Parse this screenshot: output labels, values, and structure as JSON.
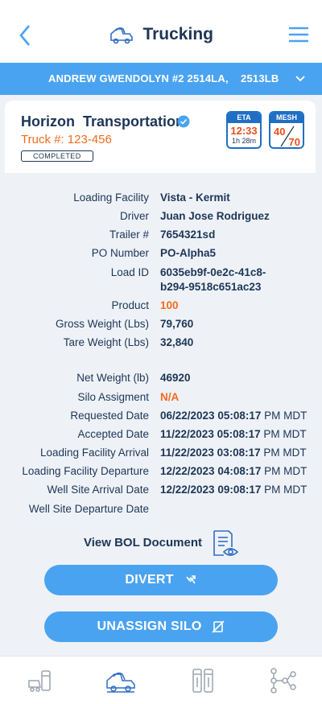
{
  "header": {
    "title": "Trucking",
    "back_icon": "back-icon",
    "truck_icon": "truck-icon",
    "menu_icon": "menu-icon"
  },
  "selector": {
    "label": "ANDREW GWENDOLYN #2 2514LA,    2513LB",
    "chevron_icon": "chevron-down-icon"
  },
  "card": {
    "company": "Horizon  Transportation",
    "truck_number": "Truck #: 123-456",
    "status": "COMPLETED",
    "eta": {
      "header": "ETA",
      "time": "12:33",
      "duration": "1h 28m"
    },
    "mesh": {
      "header": "MESH",
      "top": "40",
      "bottom": "70"
    }
  },
  "details": [
    {
      "key": "Loading Facility",
      "value": "Vista - Kermit"
    },
    {
      "key": "Driver",
      "value": "Juan Jose Rodriguez"
    },
    {
      "key": "Trailer #",
      "value": "7654321sd"
    },
    {
      "key": "PO Number",
      "value": "PO-Alpha5"
    },
    {
      "key": "Load ID",
      "value": "6035eb9f-0e2c-41c8-",
      "value2": "b294-9518c651ac23"
    },
    {
      "key": "Product",
      "value": "100"
    },
    {
      "key": "Gross Weight (Lbs)",
      "value": "79,760"
    },
    {
      "key": "Tare Weight (Lbs)",
      "value": "32,840"
    },
    {
      "key": "Net Weight (lb)",
      "value": "46920"
    },
    {
      "key": "Silo Assigment",
      "value": "N/A"
    },
    {
      "key": "Requested Date",
      "value": "06/22/2023 05:08:17",
      "suffix": " PM MDT"
    },
    {
      "key": "Accepted Date",
      "value": "11/22/2023 05:08:17",
      "suffix": " PM MDT"
    },
    {
      "key": "Loading Facility Arrival",
      "value": "11/22/2023 03:08:17",
      "suffix": " PM MDT"
    },
    {
      "key": "Loading Facility Departure",
      "value": "12/22/2023 04:08:17",
      "suffix": " PM MDT"
    },
    {
      "key": "Well Site Arrival Date",
      "value": "12/22/2023 09:08:17",
      "suffix": " PM MDT"
    },
    {
      "key": "Well Site Departure Date",
      "value": ""
    }
  ],
  "bol": {
    "label": "View BOL Document",
    "icon": "document-view-icon"
  },
  "buttons": {
    "divert": "DIVERT",
    "unassign": "UNASSIGN SILO"
  },
  "tabs": [
    "silo-truck-icon",
    "trucking-icon",
    "silos-icon",
    "network-icon"
  ],
  "colors": {
    "primary": "#4aa3f0",
    "navy": "#1d3557",
    "accent": "#f26b1d"
  }
}
